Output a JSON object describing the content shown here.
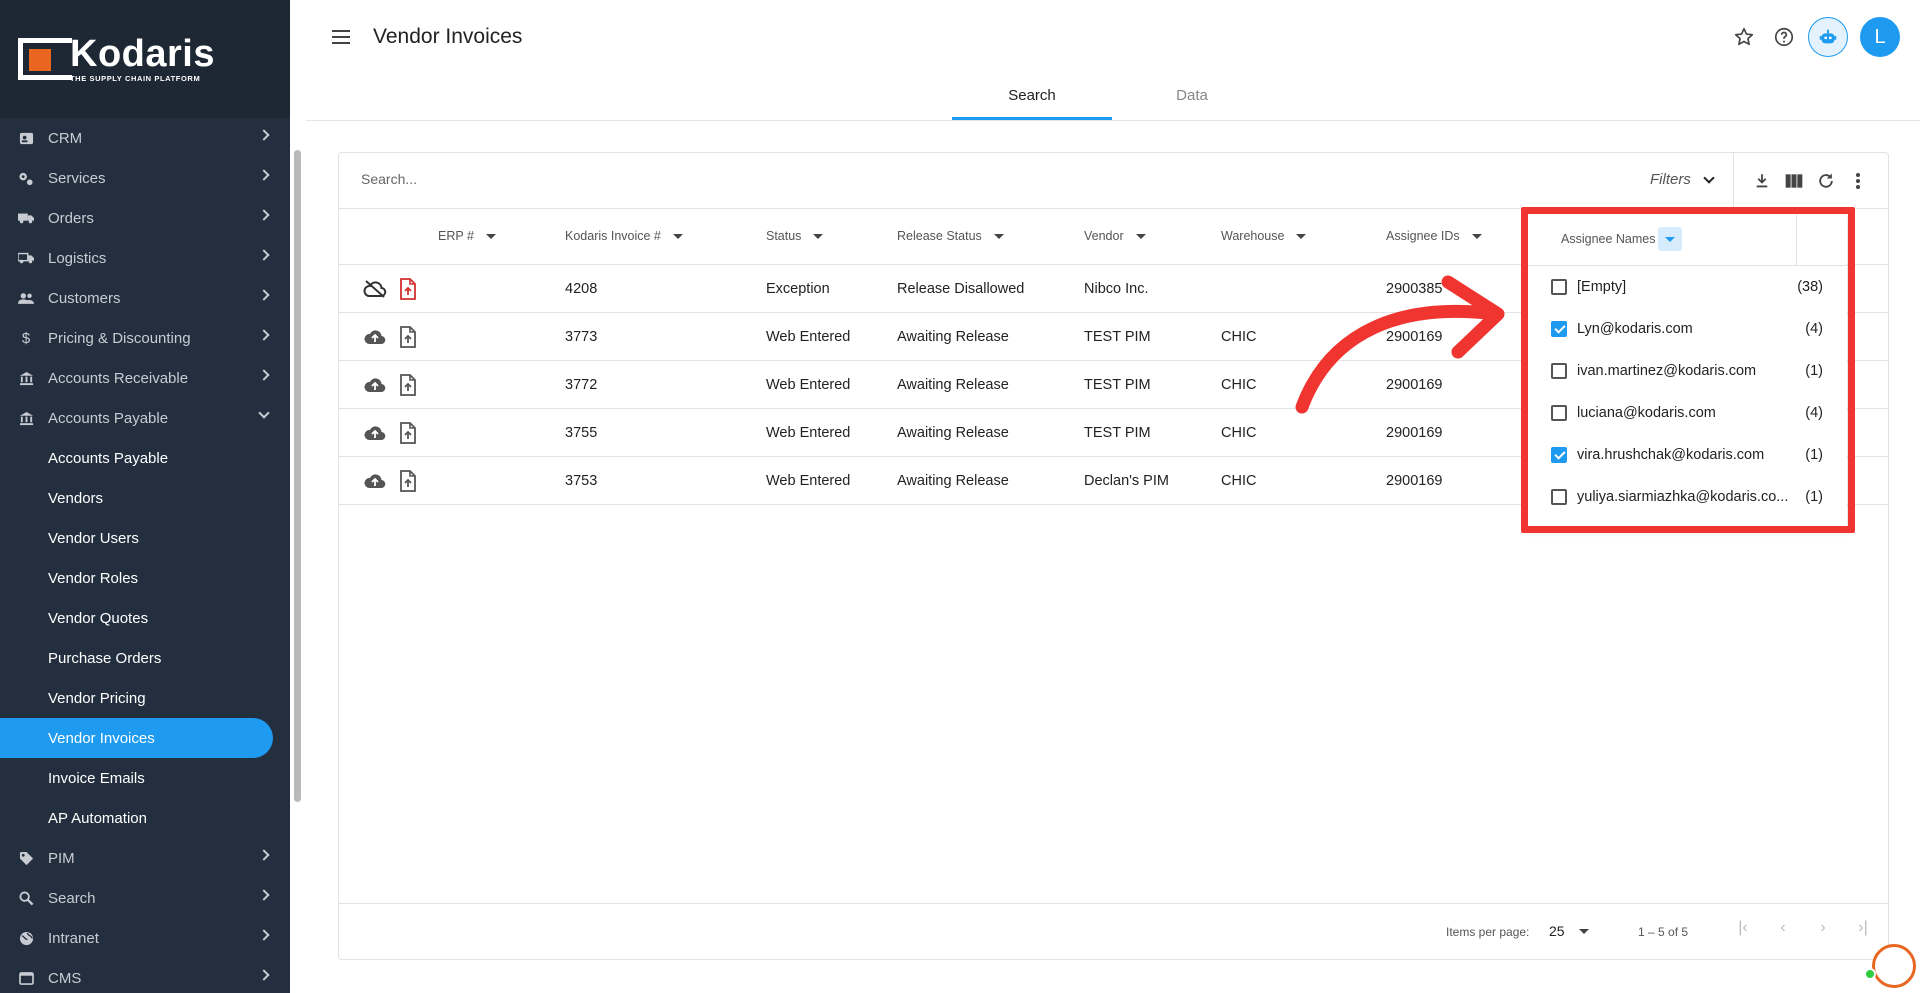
{
  "brand": {
    "name": "Kodaris",
    "tagline": "THE SUPPLY CHAIN PLATFORM",
    "accent": "#1e9bf0",
    "logo_color": "#e8661f"
  },
  "sidebar": {
    "items": [
      {
        "label": "CRM",
        "icon": "contact-card-icon"
      },
      {
        "label": "Services",
        "icon": "gears-icon"
      },
      {
        "label": "Orders",
        "icon": "truck-icon"
      },
      {
        "label": "Logistics",
        "icon": "shipping-truck-icon"
      },
      {
        "label": "Customers",
        "icon": "people-icon"
      },
      {
        "label": "Pricing & Discounting",
        "icon": "dollar-icon"
      },
      {
        "label": "Accounts Receivable",
        "icon": "bank-icon"
      },
      {
        "label": "Accounts Payable",
        "icon": "bank-icon",
        "expanded": true
      }
    ],
    "sub_items": [
      {
        "label": "Accounts Payable"
      },
      {
        "label": "Vendors"
      },
      {
        "label": "Vendor Users"
      },
      {
        "label": "Vendor Roles"
      },
      {
        "label": "Vendor Quotes"
      },
      {
        "label": "Purchase Orders"
      },
      {
        "label": "Vendor Pricing"
      },
      {
        "label": "Vendor Invoices",
        "active": true
      },
      {
        "label": "Invoice Emails"
      },
      {
        "label": "AP Automation"
      }
    ],
    "bottom_items": [
      {
        "label": "PIM",
        "icon": "tag-icon"
      },
      {
        "label": "Search",
        "icon": "search-icon"
      },
      {
        "label": "Intranet",
        "icon": "globe-icon"
      },
      {
        "label": "CMS",
        "icon": "browser-icon"
      }
    ]
  },
  "header": {
    "title": "Vendor Invoices",
    "avatar_letter": "L",
    "tabs": [
      {
        "label": "Search",
        "active": true
      },
      {
        "label": "Data",
        "active": false
      }
    ]
  },
  "toolbar": {
    "search_placeholder": "Search...",
    "filters_label": "Filters"
  },
  "table": {
    "columns": [
      "ERP #",
      "Kodaris Invoice #",
      "Status",
      "Release Status",
      "Vendor",
      "Warehouse",
      "Assignee IDs",
      "Assignee Names"
    ],
    "rows": [
      {
        "kodaris": "4208",
        "status": "Exception",
        "release": "Release Disallowed",
        "vendor": "Nibco Inc.",
        "warehouse": "",
        "assignee_ids": "2900385",
        "sync_icon": "cloud-off-icon",
        "file_icon_color": "#d32f2f"
      },
      {
        "kodaris": "3773",
        "status": "Web Entered",
        "release": "Awaiting Release",
        "vendor": "TEST PIM",
        "warehouse": "CHIC",
        "assignee_ids": "2900169",
        "sync_icon": "cloud-upload-icon",
        "file_icon_color": "#555"
      },
      {
        "kodaris": "3772",
        "status": "Web Entered",
        "release": "Awaiting Release",
        "vendor": "TEST PIM",
        "warehouse": "CHIC",
        "assignee_ids": "2900169",
        "sync_icon": "cloud-upload-icon",
        "file_icon_color": "#555"
      },
      {
        "kodaris": "3755",
        "status": "Web Entered",
        "release": "Awaiting Release",
        "vendor": "TEST PIM",
        "warehouse": "CHIC",
        "assignee_ids": "2900169",
        "sync_icon": "cloud-upload-icon",
        "file_icon_color": "#555"
      },
      {
        "kodaris": "3753",
        "status": "Web Entered",
        "release": "Awaiting Release",
        "vendor": "Declan's PIM",
        "warehouse": "CHIC",
        "assignee_ids": "2900169",
        "sync_icon": "cloud-upload-icon",
        "file_icon_color": "#555"
      }
    ]
  },
  "assignee_filter": {
    "header": "Assignee Names",
    "options": [
      {
        "label": "[Empty]",
        "count": "(38)",
        "checked": false
      },
      {
        "label": "Lyn@kodaris.com",
        "count": "(4)",
        "checked": true
      },
      {
        "label": "ivan.martinez@kodaris.com",
        "count": "(1)",
        "checked": false
      },
      {
        "label": "luciana@kodaris.com",
        "count": "(4)",
        "checked": false
      },
      {
        "label": "vira.hrushchak@kodaris.com",
        "count": "(1)",
        "checked": true
      },
      {
        "label": "yuliya.siarmiazhka@kodaris.co...",
        "count": "(1)",
        "checked": false
      }
    ],
    "highlight_color": "#f03530"
  },
  "pagination": {
    "items_per_page_label": "Items per page:",
    "items_per_page": "25",
    "range": "1 – 5 of 5"
  }
}
